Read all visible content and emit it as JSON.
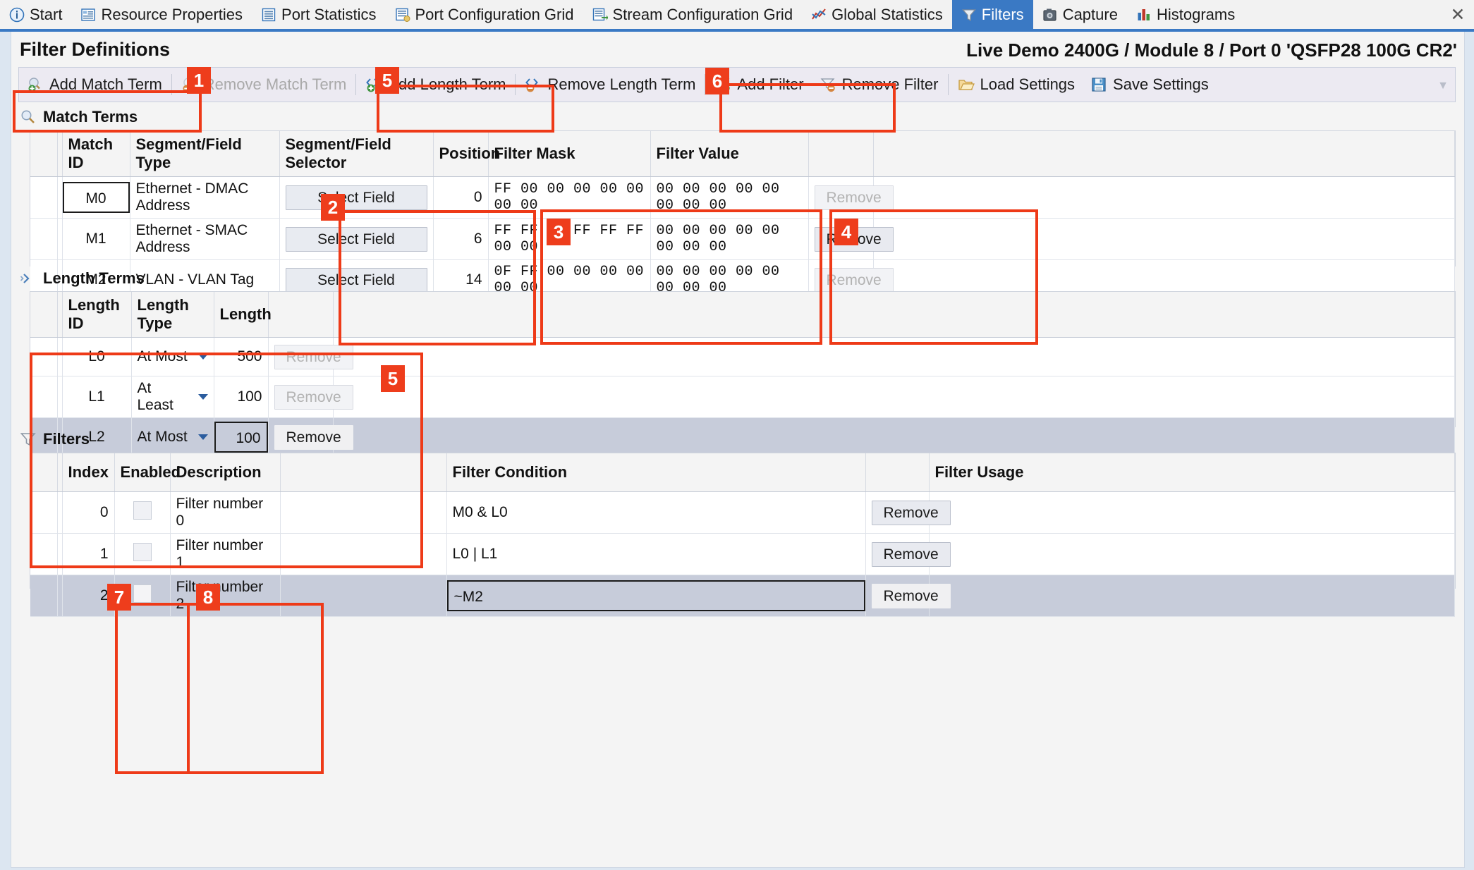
{
  "tabs": [
    {
      "label": "Start",
      "icon": "info-icon",
      "active": false
    },
    {
      "label": "Resource Properties",
      "icon": "properties-icon",
      "active": false
    },
    {
      "label": "Port Statistics",
      "icon": "list-icon",
      "active": false
    },
    {
      "label": "Port Configuration Grid",
      "icon": "grid-icon",
      "active": false
    },
    {
      "label": "Stream Configuration Grid",
      "icon": "stream-grid-icon",
      "active": false
    },
    {
      "label": "Global Statistics",
      "icon": "chart-icon",
      "active": false
    },
    {
      "label": "Filters",
      "icon": "funnel-icon",
      "active": true
    },
    {
      "label": "Capture",
      "icon": "camera-icon",
      "active": false
    },
    {
      "label": "Histograms",
      "icon": "histogram-icon",
      "active": false
    }
  ],
  "window": {
    "close_label": "✕"
  },
  "header": {
    "title": "Filter Definitions",
    "context": "Live Demo 2400G / Module 8 / Port 0 'QSFP28 100G CR2'"
  },
  "toolbar": {
    "items": [
      {
        "label": "Add Match Term",
        "icon": "add-match-term-icon",
        "disabled": false
      },
      {
        "label": "Remove Match Term",
        "icon": "remove-match-term-icon",
        "disabled": true
      },
      {
        "label": "Add Length Term",
        "icon": "add-length-term-icon",
        "disabled": false
      },
      {
        "label": "Remove Length Term",
        "icon": "remove-length-term-icon",
        "disabled": false
      },
      {
        "label": "Add Filter",
        "icon": "add-filter-icon",
        "disabled": false
      },
      {
        "label": "Remove Filter",
        "icon": "remove-filter-icon",
        "disabled": false
      },
      {
        "label": "Load Settings",
        "icon": "folder-open-icon",
        "disabled": false
      },
      {
        "label": "Save Settings",
        "icon": "save-disk-icon",
        "disabled": false
      }
    ],
    "overflow_glyph": "▼"
  },
  "match_terms": {
    "section_title": "Match Terms",
    "section_icon": "magnifier-icon",
    "columns": [
      "",
      "Match ID",
      "Segment/Field Type",
      "Segment/Field Selector",
      "Position",
      "Filter Mask",
      "Filter Value",
      "",
      ""
    ],
    "rows": [
      {
        "match_id": "M0",
        "field_type": "Ethernet - DMAC Address",
        "selector_label": "Select Field",
        "position": "0",
        "filter_mask": "FF 00 00 00 00 00 00 00",
        "filter_value": "00 00 00 00 00 00 00 00",
        "remove_label": "Remove",
        "remove_disabled": true,
        "selected_cell": true
      },
      {
        "match_id": "M1",
        "field_type": "Ethernet - SMAC Address",
        "selector_label": "Select Field",
        "position": "6",
        "filter_mask": "FF FF FF FF FF FF 00 00",
        "filter_value": "00 00 00 00 00 00 00 00",
        "remove_label": "Remove",
        "remove_disabled": false,
        "selected_cell": false
      },
      {
        "match_id": "M2",
        "field_type": "VLAN - VLAN Tag",
        "selector_label": "Select Field",
        "position": "14",
        "filter_mask": "0F FF 00 00 00 00 00 00",
        "filter_value": "00 00 00 00 00 00 00 00",
        "remove_label": "Remove",
        "remove_disabled": true,
        "selected_cell": false
      }
    ]
  },
  "length_terms": {
    "section_title": "Length Terms",
    "section_icon": "expander-icon",
    "columns": [
      "",
      "Length ID",
      "Length Type",
      "Length",
      ""
    ],
    "rows": [
      {
        "length_id": "L0",
        "length_type": "At Most",
        "length": "500",
        "remove_label": "Remove",
        "remove_disabled": true,
        "selected": false,
        "length_boxed": false
      },
      {
        "length_id": "L1",
        "length_type": "At Least",
        "length": "100",
        "remove_label": "Remove",
        "remove_disabled": true,
        "selected": false,
        "length_boxed": false
      },
      {
        "length_id": "L2",
        "length_type": "At Most",
        "length": "100",
        "remove_label": "Remove",
        "remove_disabled": false,
        "selected": true,
        "length_boxed": true
      }
    ]
  },
  "filters": {
    "section_title": "Filters",
    "section_icon": "funnel-icon",
    "columns": [
      "",
      "Index",
      "Enabled",
      "Description",
      "",
      "Filter Condition",
      "",
      "Filter Usage"
    ],
    "rows": [
      {
        "index": "0",
        "enabled": false,
        "description": "Filter number 0",
        "condition": "M0 & L0",
        "usage": "",
        "remove_label": "Remove",
        "selected": false,
        "condition_boxed": false
      },
      {
        "index": "1",
        "enabled": false,
        "description": "Filter number 1",
        "condition": "L0  |  L1",
        "usage": "",
        "remove_label": "Remove",
        "selected": false,
        "condition_boxed": false
      },
      {
        "index": "2",
        "enabled": false,
        "description": "Filter number 2",
        "condition": "~M2",
        "usage": "",
        "remove_label": "Remove",
        "selected": true,
        "condition_boxed": true
      }
    ]
  },
  "annotations": {
    "accent_color": "#ee3d1c",
    "callouts": [
      {
        "number": "1",
        "target": "add-match-term-button"
      },
      {
        "number": "2",
        "target": "segment-field-selector-column"
      },
      {
        "number": "3",
        "target": "position-and-filter-mask-columns"
      },
      {
        "number": "4",
        "target": "filter-value-column"
      },
      {
        "number": "5",
        "target": "add-length-term-and-length-terms-grid"
      },
      {
        "number": "6",
        "target": "add-filter-button"
      },
      {
        "number": "7",
        "target": "enabled-column"
      },
      {
        "number": "8",
        "target": "description-column"
      }
    ]
  }
}
